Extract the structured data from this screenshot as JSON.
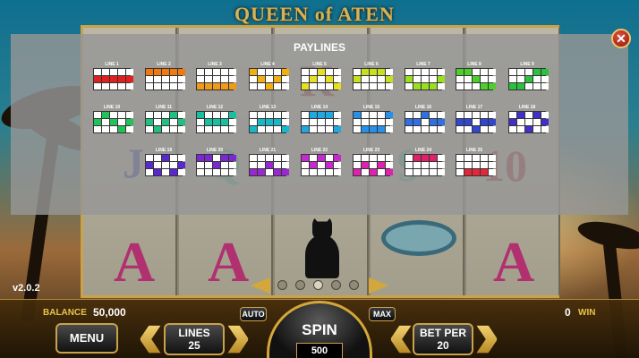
{
  "game": {
    "title": "QUEEN of ATEN",
    "version": "v2.0.2"
  },
  "paytable": {
    "title": "PAYLINES",
    "close_label": "✕",
    "lines": [
      {
        "label": "LINE 1",
        "color": "#e02020",
        "cells": [
          0,
          0,
          0,
          0,
          0,
          1,
          1,
          1,
          1,
          1,
          0,
          0,
          0,
          0,
          0
        ]
      },
      {
        "label": "LINE 2",
        "color": "#f07a10",
        "cells": [
          1,
          1,
          1,
          1,
          1,
          0,
          0,
          0,
          0,
          0,
          0,
          0,
          0,
          0,
          0
        ]
      },
      {
        "label": "LINE 3",
        "color": "#f09a18",
        "cells": [
          0,
          0,
          0,
          0,
          0,
          0,
          0,
          0,
          0,
          0,
          1,
          1,
          1,
          1,
          1
        ]
      },
      {
        "label": "LINE 4",
        "color": "#f2b010",
        "cells": [
          1,
          0,
          0,
          0,
          1,
          0,
          1,
          0,
          1,
          0,
          0,
          0,
          1,
          0,
          0
        ]
      },
      {
        "label": "LINE 5",
        "color": "#e6e020",
        "cells": [
          0,
          0,
          1,
          0,
          0,
          0,
          1,
          0,
          1,
          0,
          1,
          0,
          0,
          0,
          1
        ]
      },
      {
        "label": "LINE 6",
        "color": "#c8e020",
        "cells": [
          0,
          1,
          1,
          1,
          0,
          1,
          0,
          0,
          0,
          1,
          0,
          0,
          0,
          0,
          0
        ]
      },
      {
        "label": "LINE 7",
        "color": "#9ae020",
        "cells": [
          0,
          0,
          0,
          0,
          0,
          1,
          0,
          0,
          0,
          1,
          0,
          1,
          1,
          1,
          0
        ]
      },
      {
        "label": "LINE 8",
        "color": "#4ccf2a",
        "cells": [
          1,
          1,
          0,
          0,
          0,
          0,
          0,
          1,
          0,
          0,
          0,
          0,
          0,
          1,
          1
        ]
      },
      {
        "label": "LINE 9",
        "color": "#2ac040",
        "cells": [
          0,
          0,
          0,
          1,
          1,
          0,
          0,
          1,
          0,
          0,
          1,
          1,
          0,
          0,
          0
        ]
      },
      {
        "label": "LINE 10",
        "color": "#22c25a",
        "cells": [
          0,
          1,
          0,
          0,
          0,
          1,
          0,
          1,
          0,
          1,
          0,
          0,
          0,
          1,
          0
        ]
      },
      {
        "label": "LINE 11",
        "color": "#20c080",
        "cells": [
          0,
          0,
          0,
          1,
          0,
          1,
          0,
          1,
          0,
          1,
          0,
          1,
          0,
          0,
          0
        ]
      },
      {
        "label": "LINE 12",
        "color": "#18c0a0",
        "cells": [
          1,
          0,
          0,
          0,
          1,
          0,
          1,
          1,
          1,
          0,
          0,
          0,
          0,
          0,
          0
        ]
      },
      {
        "label": "LINE 13",
        "color": "#18b8c8",
        "cells": [
          0,
          0,
          0,
          0,
          0,
          0,
          1,
          1,
          1,
          0,
          1,
          0,
          0,
          0,
          1
        ]
      },
      {
        "label": "LINE 14",
        "color": "#20a8e0",
        "cells": [
          0,
          1,
          1,
          1,
          0,
          0,
          0,
          0,
          0,
          0,
          1,
          0,
          0,
          0,
          1
        ]
      },
      {
        "label": "LINE 15",
        "color": "#2890e8",
        "cells": [
          1,
          0,
          0,
          0,
          1,
          0,
          0,
          0,
          0,
          0,
          0,
          1,
          1,
          1,
          0
        ]
      },
      {
        "label": "LINE 16",
        "color": "#3070e0",
        "cells": [
          0,
          0,
          1,
          0,
          0,
          1,
          1,
          0,
          1,
          1,
          0,
          0,
          0,
          0,
          0
        ]
      },
      {
        "label": "LINE 17",
        "color": "#3048d0",
        "cells": [
          0,
          0,
          0,
          0,
          0,
          1,
          1,
          0,
          1,
          1,
          0,
          0,
          1,
          0,
          0
        ]
      },
      {
        "label": "LINE 18",
        "color": "#4030c8",
        "cells": [
          0,
          1,
          0,
          1,
          0,
          1,
          0,
          0,
          0,
          1,
          0,
          0,
          1,
          0,
          0
        ]
      },
      {
        "label": "LINE 19",
        "color": "#5a28d0",
        "cells": [
          0,
          0,
          1,
          0,
          0,
          1,
          0,
          0,
          0,
          1,
          0,
          1,
          0,
          1,
          0
        ]
      },
      {
        "label": "LINE 20",
        "color": "#7a28d0",
        "cells": [
          1,
          1,
          0,
          1,
          1,
          0,
          0,
          1,
          0,
          0,
          0,
          0,
          0,
          0,
          0
        ]
      },
      {
        "label": "LINE 21",
        "color": "#9a28d0",
        "cells": [
          0,
          0,
          0,
          0,
          0,
          0,
          0,
          1,
          0,
          0,
          1,
          1,
          0,
          1,
          1
        ]
      },
      {
        "label": "LINE 22",
        "color": "#c828d0",
        "cells": [
          1,
          0,
          1,
          0,
          1,
          0,
          1,
          0,
          1,
          0,
          0,
          0,
          0,
          0,
          0
        ]
      },
      {
        "label": "LINE 23",
        "color": "#e020b0",
        "cells": [
          0,
          0,
          0,
          0,
          0,
          0,
          1,
          0,
          1,
          0,
          1,
          0,
          1,
          0,
          1
        ]
      },
      {
        "label": "LINE 24",
        "color": "#e0206a",
        "cells": [
          0,
          1,
          1,
          1,
          0,
          0,
          0,
          0,
          0,
          0,
          0,
          0,
          0,
          0,
          0
        ]
      },
      {
        "label": "LINE 25",
        "color": "#e02838",
        "cells": [
          0,
          0,
          0,
          0,
          0,
          0,
          0,
          0,
          0,
          0,
          0,
          1,
          1,
          1,
          0
        ]
      }
    ]
  },
  "controls": {
    "balance_label": "BALANCE",
    "balance_value": "50,000",
    "win_label": "WIN",
    "win_value": "0",
    "menu_label": "MENU",
    "lines_label": "LINES",
    "lines_value": "25",
    "auto_label": "AUTO",
    "spin_label": "SPIN",
    "spin_value": "500",
    "max_label": "MAX",
    "bet_per_label": "BET PER",
    "bet_per_value": "20"
  }
}
